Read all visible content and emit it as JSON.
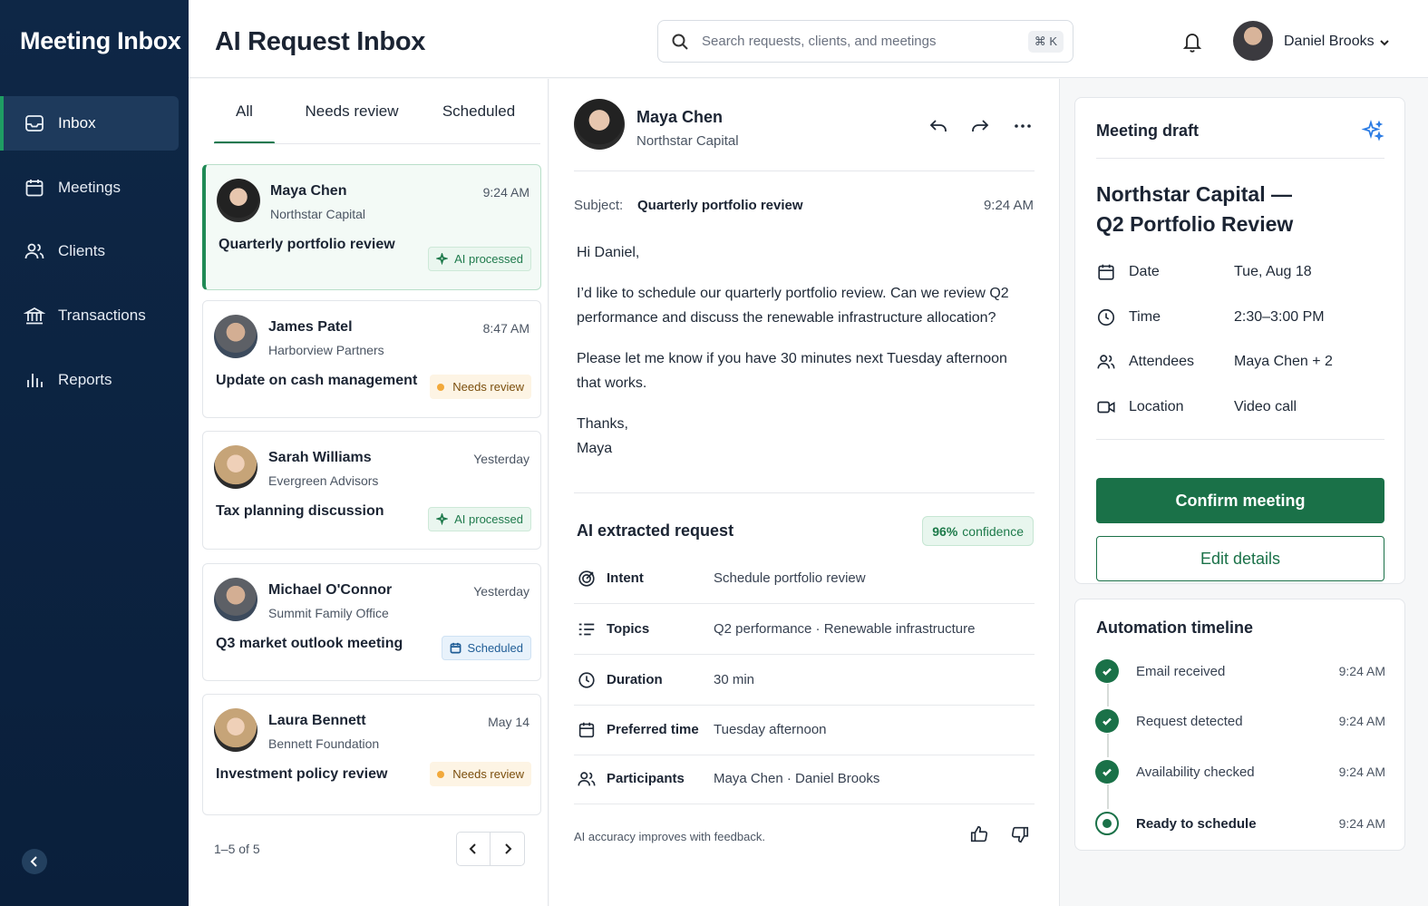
{
  "sidebar": {
    "brand": "Meeting Inbox",
    "items": [
      {
        "label": "Inbox",
        "icon": "inbox-icon",
        "active": true
      },
      {
        "label": "Meetings",
        "icon": "calendar-icon"
      },
      {
        "label": "Clients",
        "icon": "users-icon"
      },
      {
        "label": "Transactions",
        "icon": "bank-icon"
      },
      {
        "label": "Reports",
        "icon": "bar-chart-icon"
      }
    ]
  },
  "header": {
    "title": "AI Request Inbox",
    "search_placeholder": "Search requests, clients, and meetings",
    "search_shortcut": "⌘ K",
    "user_name": "Daniel Brooks"
  },
  "list": {
    "tabs": [
      "All",
      "Needs review",
      "Scheduled"
    ],
    "active_tab": "All",
    "items": [
      {
        "name": "Maya Chen",
        "company": "Northstar Capital",
        "time": "9:24 AM",
        "subject": "Quarterly portfolio review",
        "badge": "AI processed"
      },
      {
        "name": "James Patel",
        "company": "Harborview Partners",
        "time": "8:47 AM",
        "subject": "Update on cash management",
        "badge": "Needs review"
      },
      {
        "name": "Sarah Williams",
        "company": "Evergreen Advisors",
        "time": "Yesterday",
        "subject": "Tax planning discussion",
        "badge": "AI processed"
      },
      {
        "name": "Michael O'Connor",
        "company": "Summit Family Office",
        "time": "Yesterday",
        "subject": "Q3 market outlook meeting",
        "badge": "Scheduled"
      },
      {
        "name": "Laura Bennett",
        "company": "Bennett Foundation",
        "time": "May 14",
        "subject": "Investment policy review",
        "badge": "Needs review"
      }
    ],
    "pager_text": "1–5 of 5"
  },
  "detail": {
    "name": "Maya Chen",
    "company": "Northstar Capital",
    "subject_label": "Subject:",
    "subject": "Quarterly portfolio review",
    "time": "9:24 AM",
    "body": {
      "greeting": "Hi Daniel,",
      "p1": "I’d like to schedule our quarterly portfolio review. Can we review Q2 performance and discuss the renewable infrastructure allocation?",
      "p2": "Please let me know if you have 30 minutes next Tuesday afternoon that works.",
      "signoff": "Thanks,",
      "signature": "Maya"
    },
    "extracted": {
      "title": "AI extracted request",
      "confidence_value": "96%",
      "confidence_label": "confidence",
      "fields": [
        {
          "label": "Intent",
          "value": "Schedule portfolio review",
          "icon": "target-icon"
        },
        {
          "label": "Topics",
          "value": "Q2 performance  ·  Renewable infrastructure",
          "icon": "topics-icon"
        },
        {
          "label": "Duration",
          "value": "30 min",
          "icon": "clock-icon"
        },
        {
          "label": "Preferred time",
          "value": "Tuesday afternoon",
          "icon": "calendar-icon"
        },
        {
          "label": "Participants",
          "value": "Maya Chen  ·  Daniel Brooks",
          "icon": "users-icon"
        }
      ]
    },
    "feedback_text": "AI accuracy improves with feedback."
  },
  "draft": {
    "panel_title": "Meeting draft",
    "title_line1": "Northstar Capital —",
    "title_line2": "Q2 Portfolio Review",
    "rows": [
      {
        "label": "Date",
        "value": "Tue, Aug 18",
        "icon": "calendar-icon"
      },
      {
        "label": "Time",
        "value": "2:30–3:00 PM",
        "icon": "clock-icon"
      },
      {
        "label": "Attendees",
        "value": "Maya Chen + 2",
        "icon": "users-icon"
      },
      {
        "label": "Location",
        "value": "Video call",
        "icon": "video-icon"
      }
    ],
    "confirm_label": "Confirm meeting",
    "edit_label": "Edit details"
  },
  "timeline": {
    "title": "Automation timeline",
    "steps": [
      {
        "label": "Email received",
        "time": "9:24 AM",
        "status": "done"
      },
      {
        "label": "Request detected",
        "time": "9:24 AM",
        "status": "done"
      },
      {
        "label": "Availability checked",
        "time": "9:24 AM",
        "status": "done"
      },
      {
        "label": "Ready to schedule",
        "time": "9:24 AM",
        "status": "current"
      }
    ]
  },
  "colors": {
    "sidebar_bg": "#0e2746",
    "accent_green": "#1a7148",
    "ai_blue": "#2a7be4",
    "review_amber": "#f2a93b"
  }
}
